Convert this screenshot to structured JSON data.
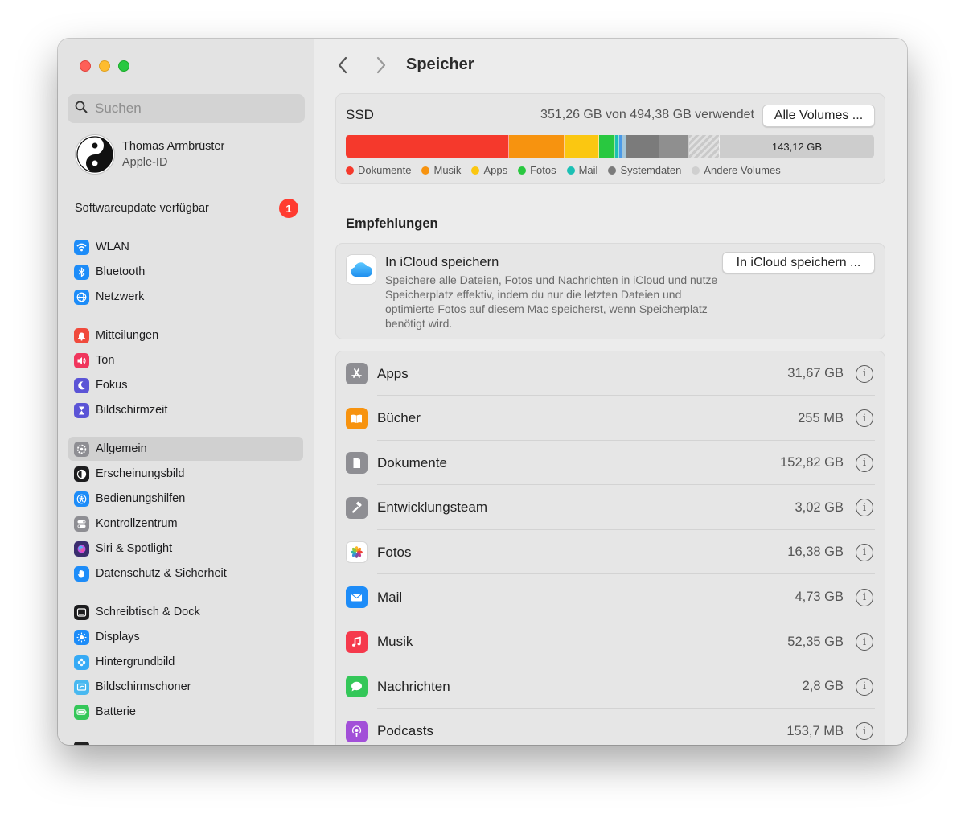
{
  "sidebar": {
    "search_placeholder": "Suchen",
    "profile": {
      "name": "Thomas Armbrüster",
      "subtitle": "Apple-ID"
    },
    "update": {
      "label": "Softwareupdate verfügbar",
      "badge": "1"
    },
    "items": [
      {
        "label": "WLAN",
        "icon": "wifi-icon",
        "color": "#1d8cf8"
      },
      {
        "label": "Bluetooth",
        "icon": "bluetooth-icon",
        "color": "#1d8cf8"
      },
      {
        "label": "Netzwerk",
        "icon": "globe-icon",
        "color": "#1d8cf8"
      },
      {
        "label": "Mitteilungen",
        "icon": "bell-icon",
        "color": "#f04a3c"
      },
      {
        "label": "Ton",
        "icon": "speaker-icon",
        "color": "#f0365d"
      },
      {
        "label": "Fokus",
        "icon": "moon-icon",
        "color": "#5b54d6"
      },
      {
        "label": "Bildschirmzeit",
        "icon": "hourglass-icon",
        "color": "#5b54d6"
      },
      {
        "label": "Allgemein",
        "icon": "gear-icon",
        "color": "#8e8e93"
      },
      {
        "label": "Erscheinungsbild",
        "icon": "appearance-icon",
        "color": "#1c1c1e"
      },
      {
        "label": "Bedienungshilfen",
        "icon": "accessibility-icon",
        "color": "#1d8cf8"
      },
      {
        "label": "Kontrollzentrum",
        "icon": "switches-icon",
        "color": "#8e8e93"
      },
      {
        "label": "Siri & Spotlight",
        "icon": "siri-icon",
        "color": "#3a2d6e"
      },
      {
        "label": "Datenschutz & Sicherheit",
        "icon": "hand-icon",
        "color": "#1d8cf8"
      },
      {
        "label": "Schreibtisch & Dock",
        "icon": "dock-icon",
        "color": "#1c1c1e"
      },
      {
        "label": "Displays",
        "icon": "sun-icon",
        "color": "#1d8cf8"
      },
      {
        "label": "Hintergrundbild",
        "icon": "flower-icon",
        "color": "#36aaf5"
      },
      {
        "label": "Bildschirmschoner",
        "icon": "screensaver-icon",
        "color": "#48b8f0"
      },
      {
        "label": "Batterie",
        "icon": "battery-icon",
        "color": "#34c759"
      }
    ],
    "selected_index": 7
  },
  "main": {
    "title": "Speicher",
    "ssd": {
      "label": "SSD",
      "used_text": "351,26 GB von 494,38 GB verwendet",
      "volumes_button": "Alle Volumes ...",
      "free_label": "143,12 GB",
      "legend": [
        {
          "label": "Dokumente",
          "color": "#f5392c"
        },
        {
          "label": "Musik",
          "color": "#f7930f"
        },
        {
          "label": "Apps",
          "color": "#fbc711"
        },
        {
          "label": "Fotos",
          "color": "#29c840"
        },
        {
          "label": "Mail",
          "color": "#1cc0b4"
        },
        {
          "label": "Systemdaten",
          "color": "#7b7b7b"
        },
        {
          "label": "Andere Volumes",
          "color": "#cfcfcf"
        }
      ]
    },
    "recommendations_title": "Empfehlungen",
    "icloud": {
      "title": "In iCloud speichern",
      "description": "Speichere alle Dateien, Fotos und Nachrichten in iCloud und nutze Speicherplatz effektiv, indem du nur die letzten Dateien und optimierte Fotos auf diesem Mac speicherst, wenn Speicherplatz benötigt wird.",
      "button": "In iCloud speichern ..."
    },
    "categories": [
      {
        "name": "Apps",
        "size": "31,67 GB",
        "icon": "app-store-icon",
        "color": "#8e8e93"
      },
      {
        "name": "Bücher",
        "size": "255 MB",
        "icon": "book-icon",
        "color": "#f7930f"
      },
      {
        "name": "Dokumente",
        "size": "152,82 GB",
        "icon": "document-icon",
        "color": "#8e8e93"
      },
      {
        "name": "Entwicklungsteam",
        "size": "3,02 GB",
        "icon": "hammer-icon",
        "color": "#8e8e93"
      },
      {
        "name": "Fotos",
        "size": "16,38 GB",
        "icon": "photos-icon",
        "color": "#ffffff"
      },
      {
        "name": "Mail",
        "size": "4,73 GB",
        "icon": "envelope-icon",
        "color": "#1d8cf8"
      },
      {
        "name": "Musik",
        "size": "52,35 GB",
        "icon": "music-note-icon",
        "color": "#f5394c"
      },
      {
        "name": "Nachrichten",
        "size": "2,8 GB",
        "icon": "speech-bubble-icon",
        "color": "#34c759"
      },
      {
        "name": "Podcasts",
        "size": "153,7 MB",
        "icon": "podcast-icon",
        "color": "#a24fd8"
      }
    ]
  }
}
